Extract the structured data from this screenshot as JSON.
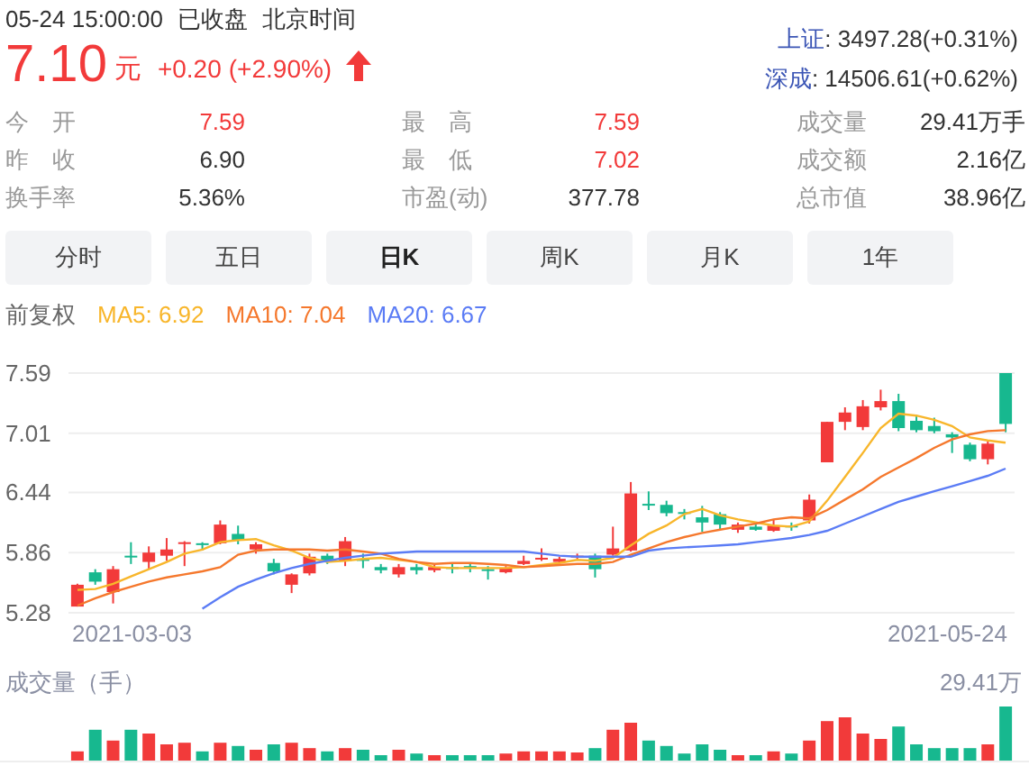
{
  "header": {
    "date_time": "05-24 15:00:00",
    "status": "已收盘",
    "timezone": "北京时间"
  },
  "quote": {
    "price": "7.10",
    "unit": "元",
    "change": "+0.20",
    "change_pct": "(+2.90%)",
    "rising": true
  },
  "indices": [
    {
      "name": "上证",
      "value": ": 3497.28(+0.31%)"
    },
    {
      "name": "深成",
      "value": ": 14506.61(+0.62%)"
    }
  ],
  "stats": [
    {
      "label": "今　开",
      "value": "7.59",
      "color": "#f23a3a"
    },
    {
      "label": "最　高",
      "value": "7.59",
      "color": "#f23a3a"
    },
    {
      "label": "成交量",
      "value": "29.41万手",
      "color": "#333333"
    },
    {
      "label": "昨　收",
      "value": "6.90",
      "color": "#333333"
    },
    {
      "label": "最　低",
      "value": "7.02",
      "color": "#f23a3a"
    },
    {
      "label": "成交额",
      "value": "2.16亿",
      "color": "#333333"
    },
    {
      "label": "换手率",
      "value": "5.36%",
      "color": "#333333"
    },
    {
      "label": "市盈(动)",
      "value": "377.78",
      "color": "#333333"
    },
    {
      "label": "总市值",
      "value": "38.96亿",
      "color": "#333333"
    }
  ],
  "tabs": [
    {
      "label": "分时",
      "selected": false
    },
    {
      "label": "五日",
      "selected": false
    },
    {
      "label": "日K",
      "selected": true
    },
    {
      "label": "周K",
      "selected": false
    },
    {
      "label": "月K",
      "selected": false
    },
    {
      "label": "1年",
      "selected": false
    }
  ],
  "chart": {
    "adjust_label": "前复权",
    "ma_readings": [
      ": 6.92",
      ": 7.04",
      ": 6.67"
    ],
    "dates": [
      "2021-03-03",
      "2021-05-24"
    ],
    "chart_data": {
      "type": "candlestick",
      "grid": true,
      "ylim": [
        5.28,
        7.59
      ],
      "yticks": [
        7.59,
        7.01,
        6.44,
        5.86,
        5.28
      ],
      "categories": [
        null,
        null,
        null,
        null,
        null,
        null,
        null,
        null,
        null,
        null,
        null,
        null,
        null,
        null,
        null,
        null,
        null,
        null,
        null,
        null,
        null,
        null,
        null,
        null,
        null,
        null,
        null,
        null,
        null,
        null,
        null,
        null,
        null,
        null,
        null,
        null,
        null,
        null,
        null,
        null,
        null,
        null,
        null,
        null,
        null,
        null,
        null,
        null,
        null,
        null,
        null,
        null,
        null
      ],
      "ohlc": [
        [
          5.34,
          5.56,
          5.34,
          5.55
        ],
        [
          5.67,
          5.7,
          5.55,
          5.58
        ],
        [
          5.48,
          5.73,
          5.37,
          5.7
        ],
        [
          5.83,
          5.96,
          5.75,
          5.82
        ],
        [
          5.77,
          5.92,
          5.7,
          5.86
        ],
        [
          5.83,
          6.0,
          5.78,
          5.89
        ],
        [
          5.95,
          5.97,
          5.73,
          5.96
        ],
        [
          5.95,
          5.96,
          5.88,
          5.94
        ],
        [
          5.95,
          6.17,
          5.94,
          6.13
        ],
        [
          6.04,
          6.12,
          5.94,
          5.98
        ],
        [
          5.89,
          5.96,
          5.85,
          5.94
        ],
        [
          5.76,
          5.8,
          5.65,
          5.68
        ],
        [
          5.55,
          5.66,
          5.47,
          5.65
        ],
        [
          5.66,
          5.85,
          5.64,
          5.82
        ],
        [
          5.83,
          5.85,
          5.75,
          5.77
        ],
        [
          5.78,
          6.01,
          5.73,
          5.97
        ],
        [
          5.8,
          5.85,
          5.71,
          5.78
        ],
        [
          5.72,
          5.75,
          5.66,
          5.69
        ],
        [
          5.65,
          5.75,
          5.62,
          5.72
        ],
        [
          5.72,
          5.75,
          5.65,
          5.69
        ],
        [
          5.69,
          5.74,
          5.67,
          5.72
        ],
        [
          5.72,
          5.75,
          5.66,
          5.71
        ],
        [
          5.73,
          5.76,
          5.67,
          5.72
        ],
        [
          5.7,
          5.73,
          5.6,
          5.69
        ],
        [
          5.67,
          5.73,
          5.66,
          5.71
        ],
        [
          5.75,
          5.83,
          5.74,
          5.78
        ],
        [
          5.8,
          5.9,
          5.78,
          5.81
        ],
        [
          5.77,
          5.82,
          5.76,
          5.8
        ],
        [
          5.82,
          5.85,
          5.8,
          5.83
        ],
        [
          5.83,
          5.85,
          5.62,
          5.7
        ],
        [
          5.84,
          6.11,
          5.83,
          5.9
        ],
        [
          5.88,
          6.54,
          5.87,
          6.43
        ],
        [
          6.33,
          6.45,
          6.27,
          6.32
        ],
        [
          6.32,
          6.36,
          6.21,
          6.24
        ],
        [
          6.25,
          6.28,
          6.18,
          6.24
        ],
        [
          6.2,
          6.31,
          6.06,
          6.15
        ],
        [
          6.23,
          6.25,
          6.08,
          6.13
        ],
        [
          6.08,
          6.15,
          6.05,
          6.13
        ],
        [
          6.11,
          6.14,
          6.07,
          6.08
        ],
        [
          6.07,
          6.18,
          6.06,
          6.12
        ],
        [
          6.12,
          6.15,
          6.07,
          6.11
        ],
        [
          6.17,
          6.42,
          6.14,
          6.37
        ],
        [
          6.73,
          7.12,
          6.73,
          7.12
        ],
        [
          7.12,
          7.26,
          7.04,
          7.21
        ],
        [
          7.07,
          7.33,
          7.04,
          7.27
        ],
        [
          7.26,
          7.43,
          7.23,
          7.32
        ],
        [
          7.32,
          7.39,
          7.03,
          7.06
        ],
        [
          7.13,
          7.19,
          7.02,
          7.04
        ],
        [
          7.08,
          7.16,
          7.01,
          7.03
        ],
        [
          7.0,
          7.02,
          6.82,
          6.97
        ],
        [
          6.9,
          6.92,
          6.74,
          6.76
        ],
        [
          6.76,
          6.93,
          6.71,
          6.91
        ],
        [
          7.59,
          7.59,
          7.02,
          7.1
        ]
      ],
      "series": [
        {
          "name": "MA5",
          "type": "line",
          "color": "#f8b62b",
          "values": [
            5.5,
            5.51,
            5.56,
            5.63,
            5.7,
            5.77,
            5.85,
            5.89,
            5.96,
            5.98,
            5.99,
            5.93,
            5.88,
            5.81,
            5.77,
            5.78,
            5.8,
            5.81,
            5.79,
            5.77,
            5.72,
            5.71,
            5.71,
            5.71,
            5.71,
            5.72,
            5.74,
            5.76,
            5.79,
            5.78,
            5.81,
            5.93,
            6.04,
            6.12,
            6.23,
            6.28,
            6.22,
            6.18,
            6.15,
            6.12,
            6.11,
            6.16,
            6.36,
            6.59,
            6.82,
            7.06,
            7.2,
            7.18,
            7.14,
            7.08,
            6.97,
            6.94,
            6.92
          ]
        },
        {
          "name": "MA10",
          "type": "line",
          "color": "#f5782d",
          "values": [
            5.35,
            5.42,
            5.48,
            5.53,
            5.58,
            5.62,
            5.65,
            5.68,
            5.72,
            5.84,
            5.88,
            5.89,
            5.89,
            5.89,
            5.88,
            5.89,
            5.87,
            5.85,
            5.8,
            5.77,
            5.75,
            5.76,
            5.76,
            5.75,
            5.74,
            5.72,
            5.73,
            5.74,
            5.75,
            5.75,
            5.77,
            5.84,
            5.9,
            5.96,
            6.01,
            6.05,
            6.08,
            6.11,
            6.14,
            6.18,
            6.2,
            6.19,
            6.27,
            6.37,
            6.47,
            6.59,
            6.68,
            6.77,
            6.87,
            6.95,
            7.0,
            7.03,
            7.04
          ]
        },
        {
          "name": "MA20",
          "type": "line",
          "color": "#5b7cf5",
          "values": [
            null,
            null,
            null,
            null,
            null,
            null,
            null,
            5.32,
            5.43,
            5.53,
            5.6,
            5.66,
            5.71,
            5.75,
            5.78,
            5.81,
            5.83,
            5.85,
            5.86,
            5.87,
            5.87,
            5.87,
            5.87,
            5.87,
            5.87,
            5.87,
            5.85,
            5.83,
            5.82,
            5.82,
            5.82,
            5.82,
            5.88,
            5.9,
            5.91,
            5.92,
            5.93,
            5.94,
            5.96,
            5.98,
            6.0,
            6.03,
            6.07,
            6.14,
            6.21,
            6.28,
            6.35,
            6.4,
            6.45,
            6.5,
            6.55,
            6.6,
            6.67
          ]
        }
      ]
    }
  },
  "volume": {
    "label": "成交量（手）",
    "max": "29.41万"
  }
}
